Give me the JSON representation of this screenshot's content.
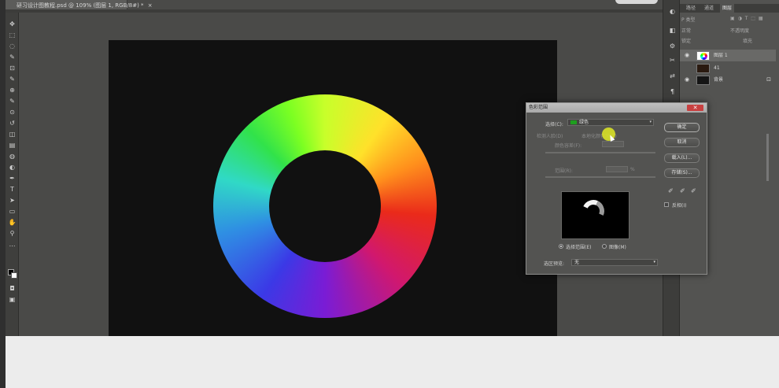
{
  "document": {
    "tab_title": "研习设计图教程.psd @ 109% (图层 1, RGB/8#) *",
    "close_glyph": "×"
  },
  "tools": {
    "icons": [
      "move-icon",
      "marquee-icon",
      "lasso-icon",
      "quick-select-icon",
      "crop-icon",
      "eyedropper-icon",
      "healing-icon",
      "brush-icon",
      "clone-stamp-icon",
      "history-brush-icon",
      "eraser-icon",
      "gradient-icon",
      "blur-icon",
      "dodge-icon",
      "pen-icon",
      "type-icon",
      "path-select-icon",
      "rectangle-icon",
      "hand-icon",
      "zoom-icon",
      "more-tools-icon"
    ],
    "glyphs": [
      "✥",
      "⬚",
      "◌",
      "✎",
      "⊡",
      "✎",
      "⊕",
      "✎",
      "⊙",
      "↺",
      "◫",
      "▤",
      "◍",
      "◐",
      "✒",
      "T",
      "➤",
      "▭",
      "✋",
      "⚲",
      "⋯"
    ]
  },
  "layers_panel": {
    "tabs": [
      "路径",
      "通道",
      "图层"
    ],
    "active_tab": "图层",
    "filter_label": "P 类型",
    "filter_icons": "▣ ◑ T ⬚ ▦",
    "mode_label": "正常",
    "opacity_label": "不透明度",
    "lock_label": "锁定",
    "fill_label": "填充",
    "layers": [
      {
        "name": "图层 1",
        "selected": true
      },
      {
        "name": "41",
        "selected": false
      },
      {
        "name": "背景",
        "selected": false
      }
    ],
    "eye_glyph": "👁",
    "lock_glyph": "🔒"
  },
  "right_strip": {
    "glyphs": [
      "◐",
      "◧",
      "⚙",
      "✂",
      "⇄",
      "¶",
      "⊞"
    ]
  },
  "color_range_dialog": {
    "title": "色彩范围",
    "close_glyph": "✕",
    "select_label": "选择(C):",
    "select_value": "绿色",
    "select_arrow": "▾",
    "localized_label": "检测人脸(D)",
    "localized_clusters": "本地化颜色簇(Z)",
    "fuzziness_label": "颜色容差(F):",
    "range_label": "范围(R):",
    "range_unit": "%",
    "buttons": {
      "ok": "确定",
      "cancel": "取消",
      "load": "载入(L)...",
      "save": "存储(S)..."
    },
    "eyedropper_glyphs": [
      "✐",
      "✐",
      "✐"
    ],
    "invert_label": "反相(I)",
    "radio_selection": "选择范围(E)",
    "radio_image": "图像(M)",
    "selected_radio": "selection",
    "preview_label": "选区预览:",
    "preview_value": "无",
    "preview_arrow": "▾"
  },
  "colors": {
    "workspace": "#4a4a48",
    "canvas": "#111111",
    "accent_cursor": "#d6de28",
    "swatch_green": "#1e9e1e"
  }
}
